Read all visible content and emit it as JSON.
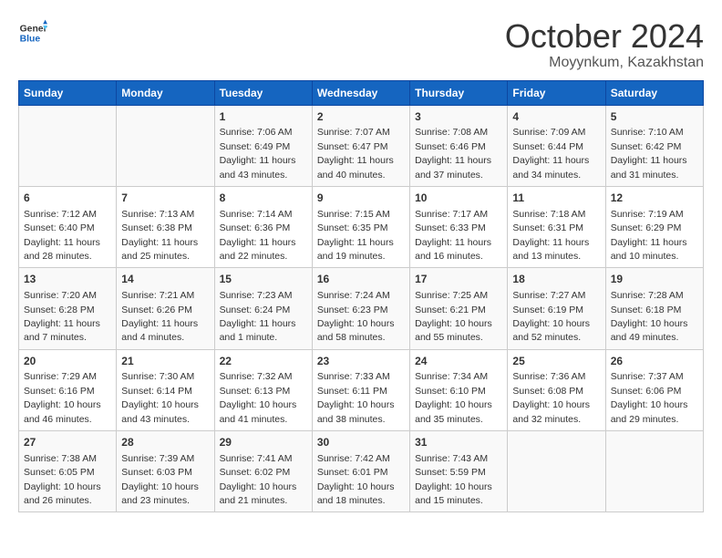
{
  "header": {
    "logo_line1": "General",
    "logo_line2": "Blue",
    "title": "October 2024",
    "subtitle": "Moyynkum, Kazakhstan"
  },
  "days_of_week": [
    "Sunday",
    "Monday",
    "Tuesday",
    "Wednesday",
    "Thursday",
    "Friday",
    "Saturday"
  ],
  "weeks": [
    [
      {
        "day": "",
        "info": ""
      },
      {
        "day": "",
        "info": ""
      },
      {
        "day": "1",
        "info": "Sunrise: 7:06 AM\nSunset: 6:49 PM\nDaylight: 11 hours and 43 minutes."
      },
      {
        "day": "2",
        "info": "Sunrise: 7:07 AM\nSunset: 6:47 PM\nDaylight: 11 hours and 40 minutes."
      },
      {
        "day": "3",
        "info": "Sunrise: 7:08 AM\nSunset: 6:46 PM\nDaylight: 11 hours and 37 minutes."
      },
      {
        "day": "4",
        "info": "Sunrise: 7:09 AM\nSunset: 6:44 PM\nDaylight: 11 hours and 34 minutes."
      },
      {
        "day": "5",
        "info": "Sunrise: 7:10 AM\nSunset: 6:42 PM\nDaylight: 11 hours and 31 minutes."
      }
    ],
    [
      {
        "day": "6",
        "info": "Sunrise: 7:12 AM\nSunset: 6:40 PM\nDaylight: 11 hours and 28 minutes."
      },
      {
        "day": "7",
        "info": "Sunrise: 7:13 AM\nSunset: 6:38 PM\nDaylight: 11 hours and 25 minutes."
      },
      {
        "day": "8",
        "info": "Sunrise: 7:14 AM\nSunset: 6:36 PM\nDaylight: 11 hours and 22 minutes."
      },
      {
        "day": "9",
        "info": "Sunrise: 7:15 AM\nSunset: 6:35 PM\nDaylight: 11 hours and 19 minutes."
      },
      {
        "day": "10",
        "info": "Sunrise: 7:17 AM\nSunset: 6:33 PM\nDaylight: 11 hours and 16 minutes."
      },
      {
        "day": "11",
        "info": "Sunrise: 7:18 AM\nSunset: 6:31 PM\nDaylight: 11 hours and 13 minutes."
      },
      {
        "day": "12",
        "info": "Sunrise: 7:19 AM\nSunset: 6:29 PM\nDaylight: 11 hours and 10 minutes."
      }
    ],
    [
      {
        "day": "13",
        "info": "Sunrise: 7:20 AM\nSunset: 6:28 PM\nDaylight: 11 hours and 7 minutes."
      },
      {
        "day": "14",
        "info": "Sunrise: 7:21 AM\nSunset: 6:26 PM\nDaylight: 11 hours and 4 minutes."
      },
      {
        "day": "15",
        "info": "Sunrise: 7:23 AM\nSunset: 6:24 PM\nDaylight: 11 hours and 1 minute."
      },
      {
        "day": "16",
        "info": "Sunrise: 7:24 AM\nSunset: 6:23 PM\nDaylight: 10 hours and 58 minutes."
      },
      {
        "day": "17",
        "info": "Sunrise: 7:25 AM\nSunset: 6:21 PM\nDaylight: 10 hours and 55 minutes."
      },
      {
        "day": "18",
        "info": "Sunrise: 7:27 AM\nSunset: 6:19 PM\nDaylight: 10 hours and 52 minutes."
      },
      {
        "day": "19",
        "info": "Sunrise: 7:28 AM\nSunset: 6:18 PM\nDaylight: 10 hours and 49 minutes."
      }
    ],
    [
      {
        "day": "20",
        "info": "Sunrise: 7:29 AM\nSunset: 6:16 PM\nDaylight: 10 hours and 46 minutes."
      },
      {
        "day": "21",
        "info": "Sunrise: 7:30 AM\nSunset: 6:14 PM\nDaylight: 10 hours and 43 minutes."
      },
      {
        "day": "22",
        "info": "Sunrise: 7:32 AM\nSunset: 6:13 PM\nDaylight: 10 hours and 41 minutes."
      },
      {
        "day": "23",
        "info": "Sunrise: 7:33 AM\nSunset: 6:11 PM\nDaylight: 10 hours and 38 minutes."
      },
      {
        "day": "24",
        "info": "Sunrise: 7:34 AM\nSunset: 6:10 PM\nDaylight: 10 hours and 35 minutes."
      },
      {
        "day": "25",
        "info": "Sunrise: 7:36 AM\nSunset: 6:08 PM\nDaylight: 10 hours and 32 minutes."
      },
      {
        "day": "26",
        "info": "Sunrise: 7:37 AM\nSunset: 6:06 PM\nDaylight: 10 hours and 29 minutes."
      }
    ],
    [
      {
        "day": "27",
        "info": "Sunrise: 7:38 AM\nSunset: 6:05 PM\nDaylight: 10 hours and 26 minutes."
      },
      {
        "day": "28",
        "info": "Sunrise: 7:39 AM\nSunset: 6:03 PM\nDaylight: 10 hours and 23 minutes."
      },
      {
        "day": "29",
        "info": "Sunrise: 7:41 AM\nSunset: 6:02 PM\nDaylight: 10 hours and 21 minutes."
      },
      {
        "day": "30",
        "info": "Sunrise: 7:42 AM\nSunset: 6:01 PM\nDaylight: 10 hours and 18 minutes."
      },
      {
        "day": "31",
        "info": "Sunrise: 7:43 AM\nSunset: 5:59 PM\nDaylight: 10 hours and 15 minutes."
      },
      {
        "day": "",
        "info": ""
      },
      {
        "day": "",
        "info": ""
      }
    ]
  ]
}
